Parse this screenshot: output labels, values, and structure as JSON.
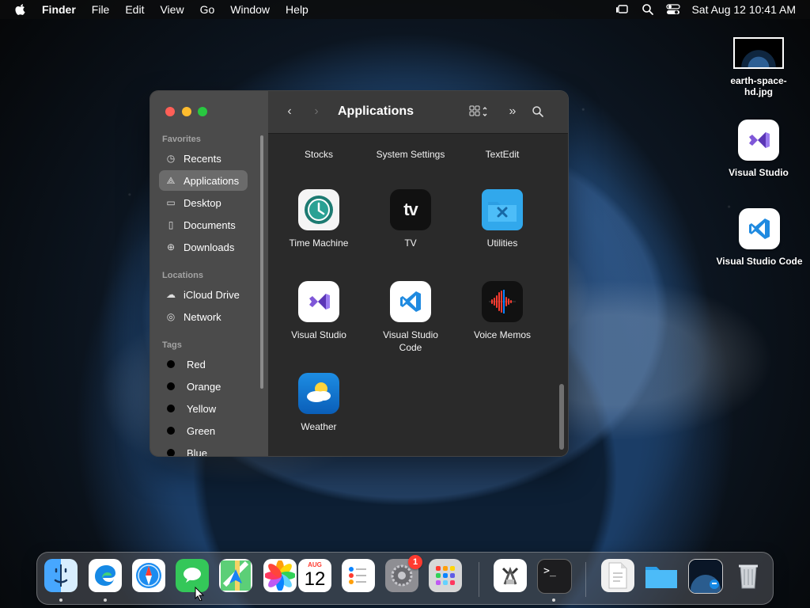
{
  "menubar": {
    "items": [
      "Finder",
      "File",
      "Edit",
      "View",
      "Go",
      "Window",
      "Help"
    ],
    "datetime": "Sat Aug 12 10:41 AM"
  },
  "desktop": {
    "items": [
      "earth-space-hd.jpg",
      "Visual Studio",
      "Visual Studio Code"
    ]
  },
  "finder": {
    "title": "Applications",
    "favorites_label": "Favorites",
    "locations_label": "Locations",
    "tags_label": "Tags",
    "favorites": [
      "Recents",
      "Applications",
      "Desktop",
      "Documents",
      "Downloads"
    ],
    "locations": [
      "iCloud Drive",
      "Network"
    ],
    "tags": [
      "Red",
      "Orange",
      "Yellow",
      "Green",
      "Blue"
    ],
    "apps": {
      "stocks": "Stocks",
      "settings": "System Settings",
      "textedit": "TextEdit",
      "timemachine": "Time Machine",
      "tv": "TV",
      "utilities": "Utilities",
      "vs": "Visual Studio",
      "vscode": "Visual Studio Code",
      "voicememos": "Voice Memos",
      "weather": "Weather"
    }
  },
  "dock": {
    "badge": "1",
    "calendar_month": "AUG",
    "calendar_day": "12"
  },
  "colors": {
    "accent": "#0a84ff",
    "vs_purple": "#7f57d8",
    "vscode_blue": "#1f8ae0",
    "folder_blue": "#31a8ec",
    "badge_red": "#ff3b30"
  }
}
